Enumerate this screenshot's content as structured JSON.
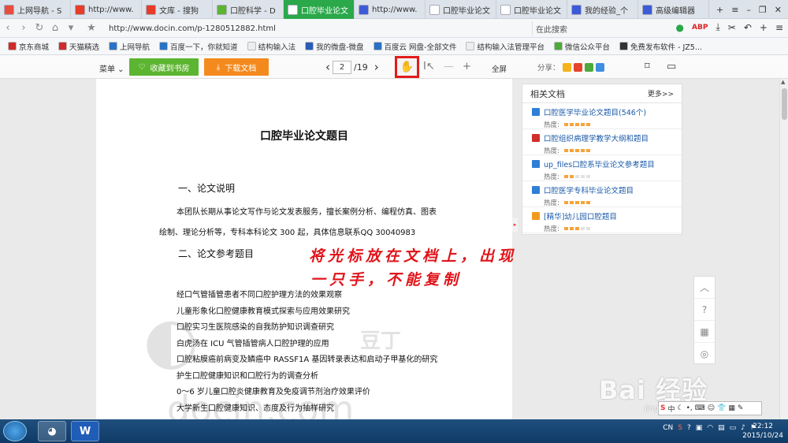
{
  "tabs": [
    {
      "label": "上网导航 - S",
      "icon_color": "#e84c3d",
      "icon": "shield-icon"
    },
    {
      "label": "http://www.",
      "icon_color": "#e83c2a",
      "icon": "s-icon"
    },
    {
      "label": "文库 - 搜狗",
      "icon_color": "#e83c2a",
      "icon": "s-icon"
    },
    {
      "label": "口腔科学 - D",
      "icon_color": "#5cb531",
      "icon": "d-icon"
    },
    {
      "label": "口腔毕业论文",
      "icon_color": "#ffffff",
      "icon": "page-icon",
      "active": true
    },
    {
      "label": "http://www.",
      "icon_color": "#3b5bd8",
      "icon": "page-icon"
    },
    {
      "label": "口腔毕业论文",
      "icon_color": "#ffffff",
      "icon": "page-icon"
    },
    {
      "label": "口腔毕业论文",
      "icon_color": "#ffffff",
      "icon": "page-icon"
    },
    {
      "label": "我的经验_个",
      "icon_color": "#3b5bd8",
      "icon": "paw-icon"
    },
    {
      "label": "高级编辑器",
      "icon_color": "#3b5bd8",
      "icon": "paw-icon"
    }
  ],
  "nav": {
    "url": "http://www.docin.com/p-1280512882.html",
    "search_placeholder": "在此搜索"
  },
  "bookmarks": [
    "京东商城",
    "天猫精选",
    "上网导航",
    "百度一下，你就知道",
    "结构输入法",
    "我的微盘-微盘",
    "百度云 网盘-全部文件",
    "结构输入法管理平台",
    "微信公众平台",
    "免费发布软件 - JZ5..."
  ],
  "toolbar": {
    "menu_label": "菜单",
    "favorite_label": "收藏到书房",
    "download_label": "下载文档",
    "current_page": "2",
    "total_pages": "/19",
    "fullscreen_label": "全屏",
    "share_label": "分享："
  },
  "doc": {
    "title": "口腔毕业论文题目",
    "section1": "一、论文说明",
    "para1_line1": "本团队长期从事论文写作与论文发表服务，擅长案例分析、编程仿真、图表",
    "para1_line2": "绘制、理论分析等，专科本科论文 300 起，具体信息联系QQ 30040983",
    "section2": "二、论文参考题目",
    "items": [
      "经口气管插管患者不同口腔护理方法的效果观察",
      "儿童形象化口腔健康教育模式探索与应用效果研究",
      "口腔实习生医院感染的自我防护知识调查研究",
      "白虎汤在 ICU 气管插管病人口腔护理的应用",
      "口腔粘膜癌前病变及鳞癌中 RASSF1A 基因转录表达和启动子甲基化的研究",
      "护生口腔健康知识和口腔行为的调查分析",
      "0～6 岁儿童口腔炎健康教育及免疫调节剂治疗效果评价",
      "大学新生口腔健康知识、态度及行为抽样研究"
    ],
    "annotation_line1": "将光标放在文档上，出现",
    "annotation_line2": "一只手，不能复制",
    "watermark_brand": "豆丁",
    "watermark_url": "docin.com"
  },
  "sidebar": {
    "title": "相关文档",
    "more": "更多>>",
    "heat_label": "热度:",
    "items": [
      {
        "name": "口腔医学毕业论文题目(546个)",
        "icon_color": "#2f7fd6",
        "heat": 5
      },
      {
        "name": "口腔组织病理学教学大纲和题目",
        "icon_color": "#d0302b",
        "heat": 5
      },
      {
        "name": "up_files口腔系毕业论文参考题目",
        "icon_color": "#2f7fd6",
        "heat": 2
      },
      {
        "name": "口腔医学专科毕业论文题目",
        "icon_color": "#2f7fd6",
        "heat": 5
      },
      {
        "name": "[精华]幼儿园口腔题目",
        "icon_color": "#f29a1f",
        "heat": 3
      }
    ]
  },
  "overlay": {
    "baidu_text": "Bai 经验",
    "baidu_sub": "jingyan.baidu.com"
  },
  "taskbar": {
    "time": "22:12",
    "date": "2015/10/24",
    "lang": "CN"
  }
}
